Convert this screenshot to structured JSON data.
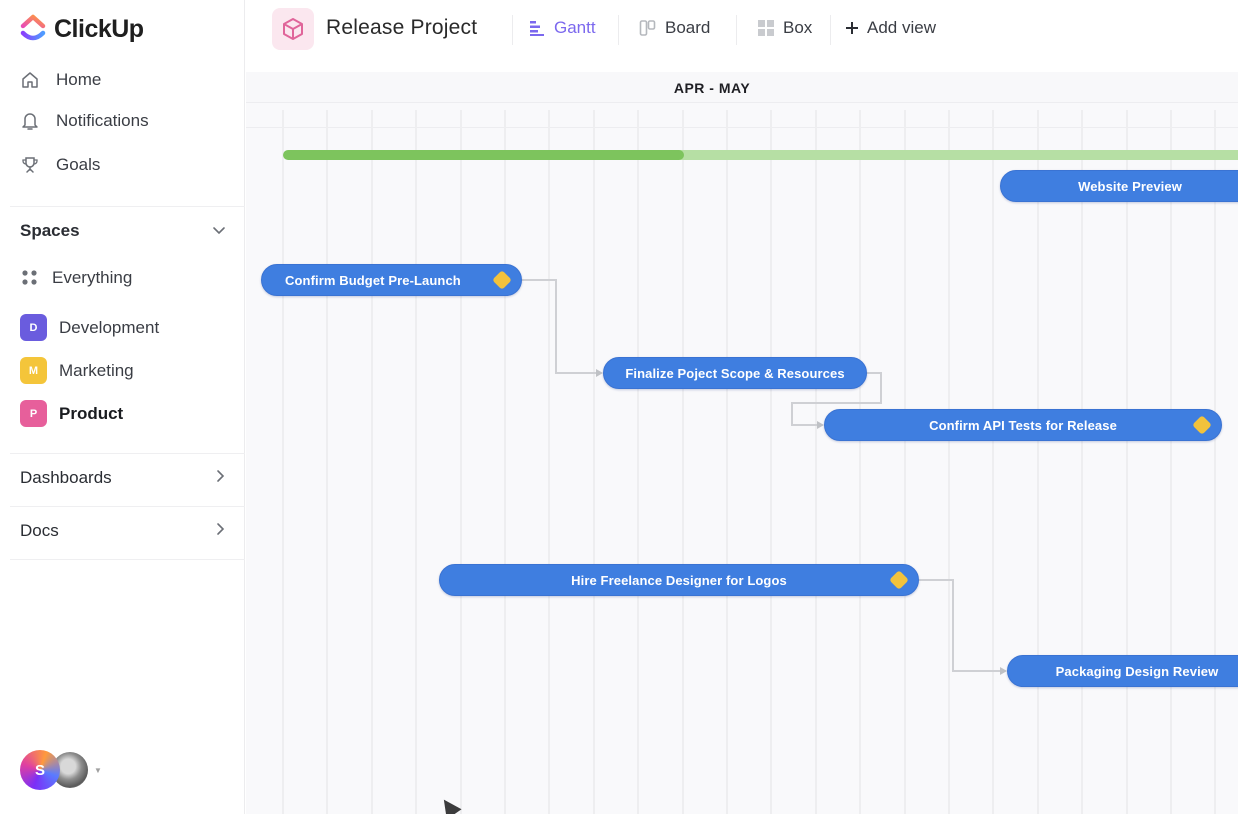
{
  "app": {
    "name": "ClickUp"
  },
  "sidebar": {
    "nav": [
      {
        "label": "Home",
        "icon": "home-icon"
      },
      {
        "label": "Notifications",
        "icon": "bell-icon"
      },
      {
        "label": "Goals",
        "icon": "trophy-icon"
      }
    ],
    "spaces": {
      "title": "Spaces",
      "items": [
        {
          "label": "Everything",
          "badge": "",
          "color": ""
        },
        {
          "label": "Development",
          "badge": "D",
          "color": "#6a5cde"
        },
        {
          "label": "Marketing",
          "badge": "M",
          "color": "#f4c53a"
        },
        {
          "label": "Product",
          "badge": "P",
          "color": "#e75f9b",
          "active": true
        }
      ]
    },
    "dashboards": "Dashboards",
    "docs": "Docs",
    "user": {
      "initial": "S"
    }
  },
  "header": {
    "project_title": "Release Project",
    "views": [
      {
        "label": "Gantt",
        "icon": "gantt-icon",
        "active": true
      },
      {
        "label": "Board",
        "icon": "board-icon"
      },
      {
        "label": "Box",
        "icon": "box-icon"
      }
    ],
    "add_view": "Add view",
    "accent": "#7b68ee"
  },
  "gantt": {
    "range_label": "APR - MAY",
    "overall_progress_pct": 42,
    "colors": {
      "task": "#3f7ee0",
      "progress": "#7dc45d",
      "progress_track": "#b6dfa4",
      "milestone": "#f2c23c"
    },
    "tasks": [
      {
        "id": "t1",
        "label": "Website Preview",
        "milestone": false
      },
      {
        "id": "t2",
        "label": "Confirm Budget Pre-Launch",
        "milestone": true
      },
      {
        "id": "t3",
        "label": "Finalize Poject Scope & Resources",
        "milestone": false
      },
      {
        "id": "t4",
        "label": "Confirm API Tests for Release",
        "milestone": true
      },
      {
        "id": "t5",
        "label": "Hire Freelance Designer for Logos",
        "milestone": true
      },
      {
        "id": "t6",
        "label": "Packaging Design Review",
        "milestone": false
      }
    ],
    "dependencies": [
      {
        "from": "t2",
        "to": "t3"
      },
      {
        "from": "t3",
        "to": "t4"
      },
      {
        "from": "t5",
        "to": "t6"
      }
    ]
  }
}
